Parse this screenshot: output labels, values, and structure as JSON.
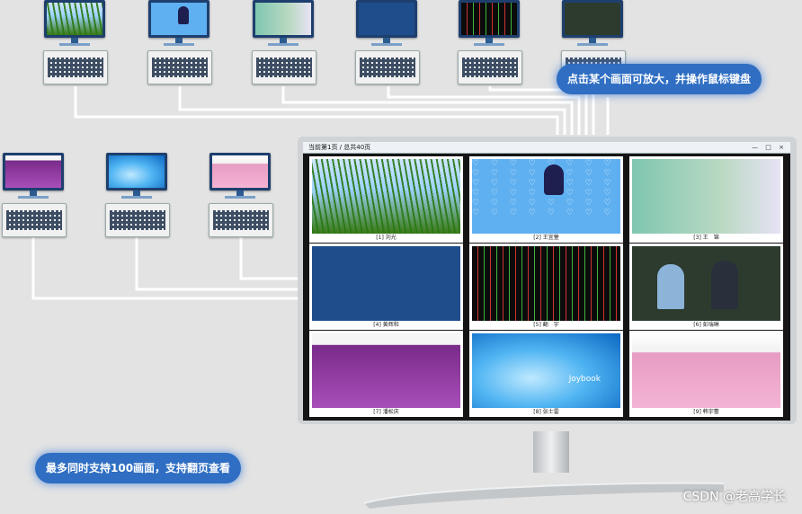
{
  "callouts": {
    "top": "点击某个画面可放大，并操作鼠标键盘",
    "bottom": "最多同时支持100画面，支持翻页查看"
  },
  "client_pcs": [
    {
      "screen": "grass"
    },
    {
      "screen": "blue-cartoon"
    },
    {
      "screen": "teal-desktop"
    },
    {
      "screen": "navy-game"
    },
    {
      "screen": "stock-chart"
    },
    {
      "screen": "video-chat"
    },
    {
      "screen": "purple-web"
    },
    {
      "screen": "blue-swirl"
    },
    {
      "screen": "pink-web"
    }
  ],
  "monitor": {
    "window_title": "当前第1页 / 总共40页",
    "window_buttons": "— □ ×",
    "cells": [
      {
        "label": "[1] 刘光",
        "screen": "grass"
      },
      {
        "label": "[2] 王宜蓥",
        "screen": "blue-cartoon"
      },
      {
        "label": "[3] 王　锦",
        "screen": "teal-desktop"
      },
      {
        "label": "[4] 黄辉和",
        "screen": "navy-game"
      },
      {
        "label": "[5] 翻　宇",
        "screen": "stock-chart"
      },
      {
        "label": "[6] 彭瑞琳",
        "screen": "video-chat"
      },
      {
        "label": "[7] 潘松庆",
        "screen": "purple-web"
      },
      {
        "label": "[8] 张士雷",
        "screen": "blue-swirl"
      },
      {
        "label": "[9] 韩宇蕾",
        "screen": "pink-web"
      }
    ],
    "brand_text": "Joybook"
  },
  "watermark": "CSDN @老高学长",
  "colors": {
    "background": "#e3e3e3",
    "callout": "#2f6ec2",
    "wire": "#ffffff"
  }
}
